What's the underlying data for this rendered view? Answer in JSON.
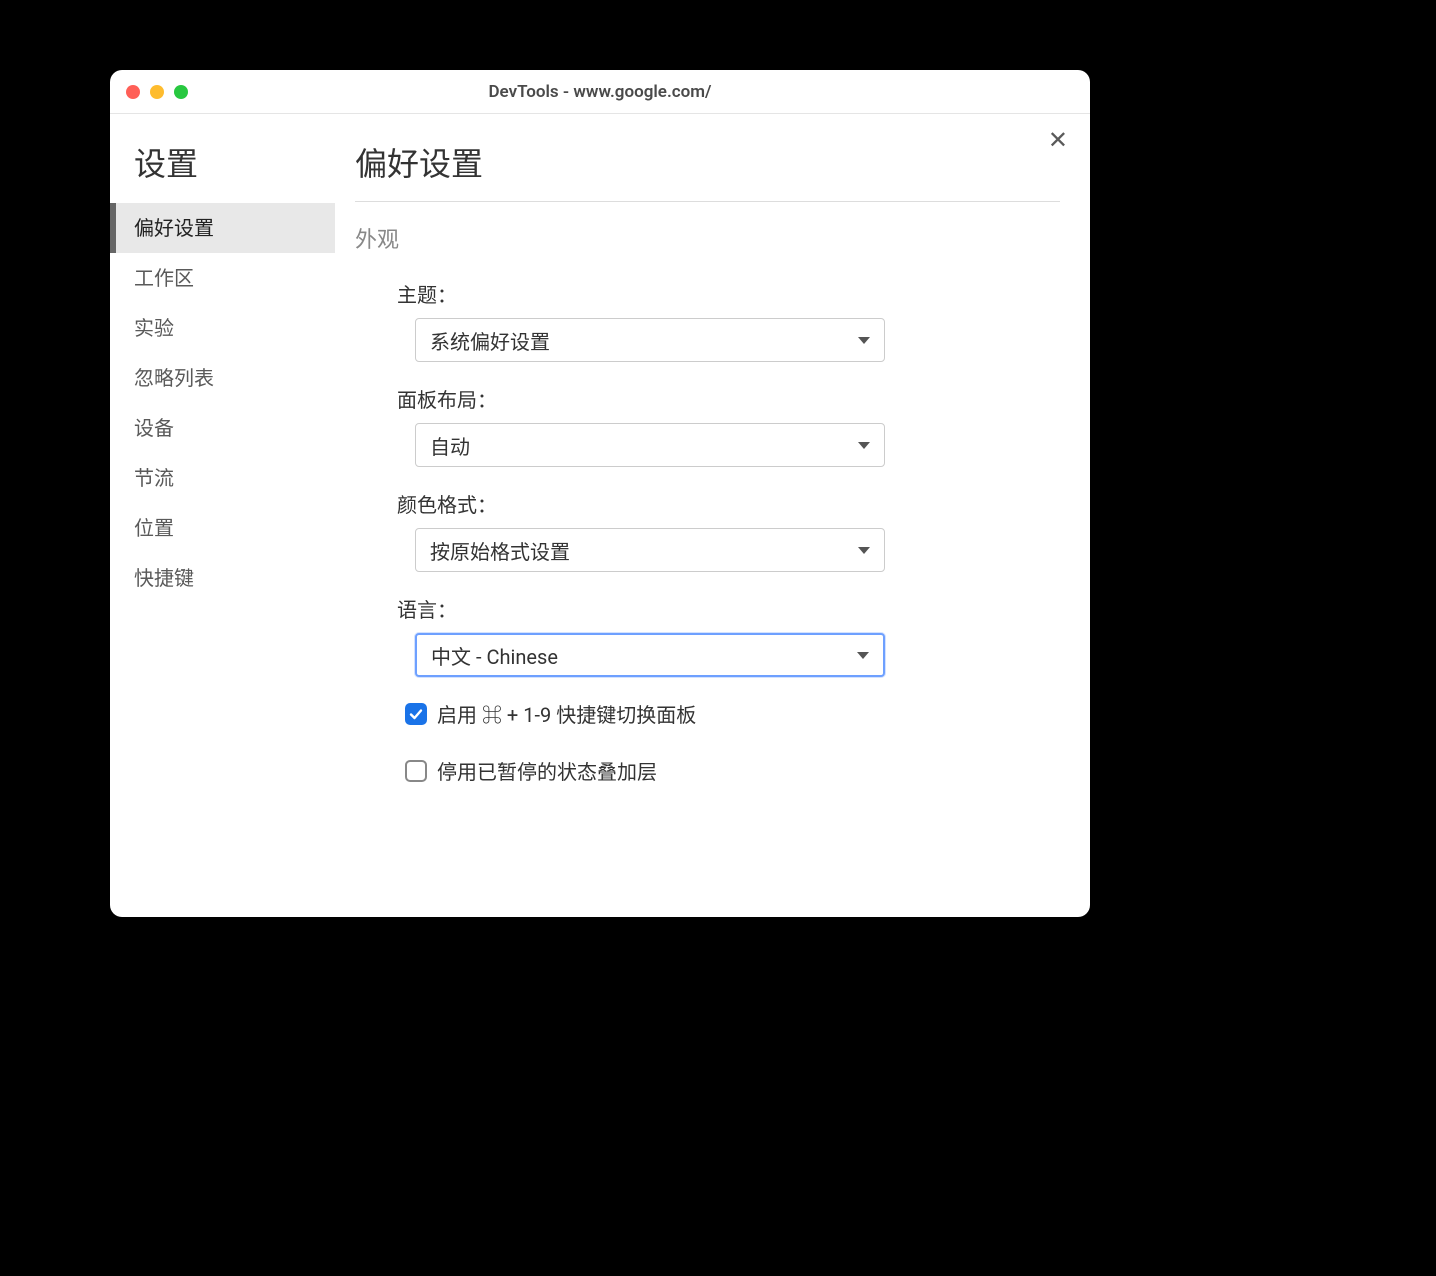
{
  "window": {
    "title": "DevTools - www.google.com/"
  },
  "sidebar": {
    "title": "设置",
    "items": [
      {
        "label": "偏好设置",
        "active": true
      },
      {
        "label": "工作区",
        "active": false
      },
      {
        "label": "实验",
        "active": false
      },
      {
        "label": "忽略列表",
        "active": false
      },
      {
        "label": "设备",
        "active": false
      },
      {
        "label": "节流",
        "active": false
      },
      {
        "label": "位置",
        "active": false
      },
      {
        "label": "快捷键",
        "active": false
      }
    ]
  },
  "main": {
    "title": "偏好设置",
    "section_label": "外观",
    "fields": {
      "theme": {
        "label": "主题：",
        "value": "系统偏好设置"
      },
      "panel_layout": {
        "label": "面板布局：",
        "value": "自动"
      },
      "color_format": {
        "label": "颜色格式：",
        "value": "按原始格式设置"
      },
      "language": {
        "label": "语言：",
        "value": "中文 - Chinese",
        "focused": true
      }
    },
    "checkboxes": {
      "enable_shortcut": {
        "label": "启用 ⌘ + 1-9 快捷键切换面板",
        "checked": true
      },
      "disable_overlay": {
        "label": "停用已暂停的状态叠加层",
        "checked": false
      }
    }
  }
}
